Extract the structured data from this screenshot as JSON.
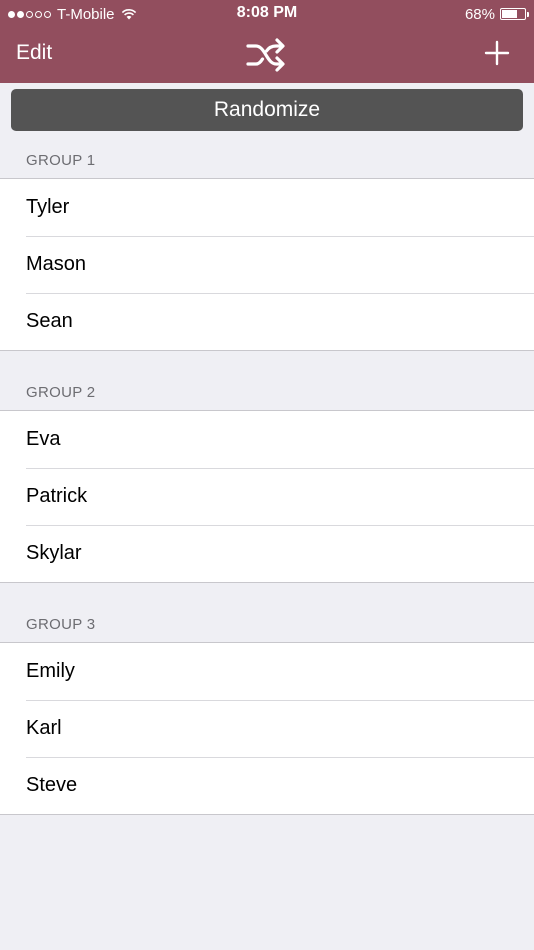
{
  "status_bar": {
    "carrier": "T-Mobile",
    "time": "8:08 PM",
    "battery": "68%",
    "battery_level": 0.68,
    "signal_filled": 2,
    "signal_total": 5
  },
  "nav": {
    "edit_label": "Edit",
    "shuffle_icon": "shuffle-icon",
    "add_icon": "plus-icon",
    "bar_color": "#924e5e"
  },
  "randomize_label": "Randomize",
  "groups": [
    {
      "title": "GROUP 1",
      "members": [
        "Tyler",
        "Mason",
        "Sean"
      ]
    },
    {
      "title": "GROUP 2",
      "members": [
        "Eva",
        "Patrick",
        "Skylar"
      ]
    },
    {
      "title": "GROUP 3",
      "members": [
        "Emily",
        "Karl",
        "Steve"
      ]
    }
  ]
}
